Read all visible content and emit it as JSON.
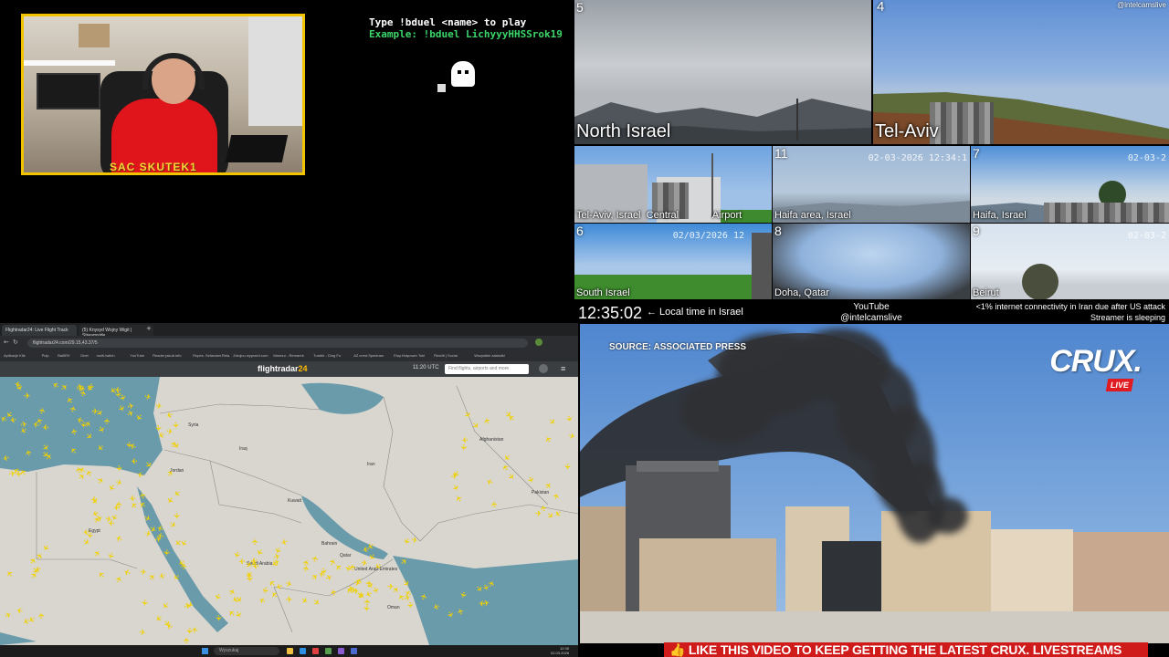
{
  "webcam": {
    "name": "SAC SKUTEK1"
  },
  "game": {
    "instruction": "Type !bduel <name> to play",
    "example": "Example: !bduel LichyyyHHSSrok19"
  },
  "cams": {
    "north_israel": {
      "number": "5",
      "label": "North Israel"
    },
    "tel_aviv_big": {
      "number": "4",
      "label": "Tel-Aviv",
      "handle": "@intelcamslive"
    },
    "tel_aviv_central": {
      "number": "",
      "label": "Tel-Aviv, Israel",
      "sub_labels": [
        "Central",
        "Airport"
      ]
    },
    "haifa_area": {
      "number": "11",
      "label": "Haifa area, Israel",
      "stamp": "02-03-2026 12:34:1"
    },
    "haifa": {
      "number": "7",
      "label": "Haifa, Israel",
      "stamp": "02-03-2"
    },
    "south_israel": {
      "number": "6",
      "label": "South Israel",
      "stamp": "02/03/2026 12"
    },
    "doha": {
      "number": "8",
      "label": "Doha, Qatar"
    },
    "beirut": {
      "number": "9",
      "label": "Beirut",
      "stamp": "02-03-2"
    }
  },
  "status": {
    "clock": "12:35:02",
    "local_time": "← Local time in Israel",
    "youtube_line1": "YouTube",
    "youtube_line2": "@intelcamslive",
    "ticker_line1": "<1% internet connectivity in Iran due after US attack",
    "ticker_line2": "Streamer is sleeping"
  },
  "browser": {
    "tabs": [
      "Flightradar24: Live Flight Track",
      "(5) Knysyd Wojny Wigit | Streamside"
    ],
    "url": "flightradar24.com/29.15,43.37/5",
    "bookmarks": [
      "Aplikacje Klik",
      "Pulp",
      "BaltiRX",
      "Onet",
      "multi-twitch",
      "YouTube",
      "Reader jakub.info",
      "Rupes. Sztandari.Rela",
      "Zdrojnu wyprzed.com",
      "Marmur - Remarek",
      "Tumblr - Ding Fo",
      "AZ crest.Spectram",
      "Eluy.Hotpower Toki",
      "Reddit | Social",
      "Wszystkie zakładki"
    ],
    "logo_main": "flightradar",
    "logo_accent": "24",
    "utc_time": "11:20 UTC",
    "search_placeholder": "Find flights, airports and more",
    "menu": "≡",
    "countries": [
      "Syria",
      "Iraq",
      "Jordan",
      "Kuwait",
      "Iran",
      "Afghanistan",
      "Pakistan",
      "Egypt",
      "Saudi Arabia",
      "Bahrain",
      "Qatar",
      "United Arab Emirates",
      "Oman"
    ],
    "taskbar_search": "Wyszukaj",
    "taskbar_time": "12:35",
    "taskbar_date": "02.03.2026"
  },
  "news": {
    "source": "SOURCE: ASSOCIATED PRESS",
    "logo": "CRUX.",
    "live": "LIVE"
  },
  "banner": {
    "text": "👍 LIKE THIS VIDEO TO KEEP GETTING THE LATEST CRUX. LIVESTREAMS"
  }
}
